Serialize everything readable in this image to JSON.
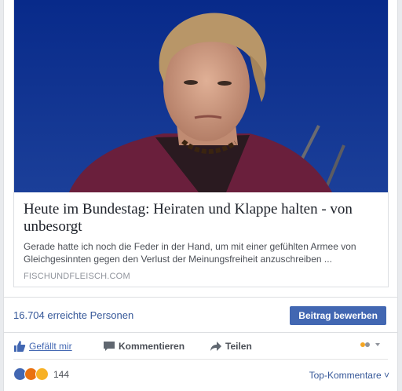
{
  "link": {
    "title": "Heute im Bundestag: Heiraten und Klappe halten - von unbesorgt",
    "description": "Gerade hatte ich noch die Feder in der Hand, um mit einer gefühlten Armee von Gleichgesinnten gegen den Verlust der Meinungsfreiheit anzuschreiben ...",
    "domain": "FISCHUNDFLEISCH.COM",
    "image_alt": "Photo of a woman with short blonde hair in a dark red jacket against a blue background"
  },
  "reach": {
    "text": "16.704 erreichte Personen",
    "boost_label": "Beitrag bewerben"
  },
  "actions": {
    "like": "Gefällt mir",
    "comment": "Kommentieren",
    "share": "Teilen"
  },
  "summary": {
    "reaction_count": "144",
    "sort_label": "Top-Kommentare ˅"
  },
  "colors": {
    "brand": "#4267b2",
    "link": "#365899",
    "photo_background": "#123a9e",
    "jacket": "#6a1f3c"
  },
  "icons": [
    "thumbs-up-icon",
    "comment-bubble-icon",
    "share-arrow-icon",
    "like-reaction-icon",
    "angry-reaction-icon",
    "sad-reaction-icon"
  ]
}
